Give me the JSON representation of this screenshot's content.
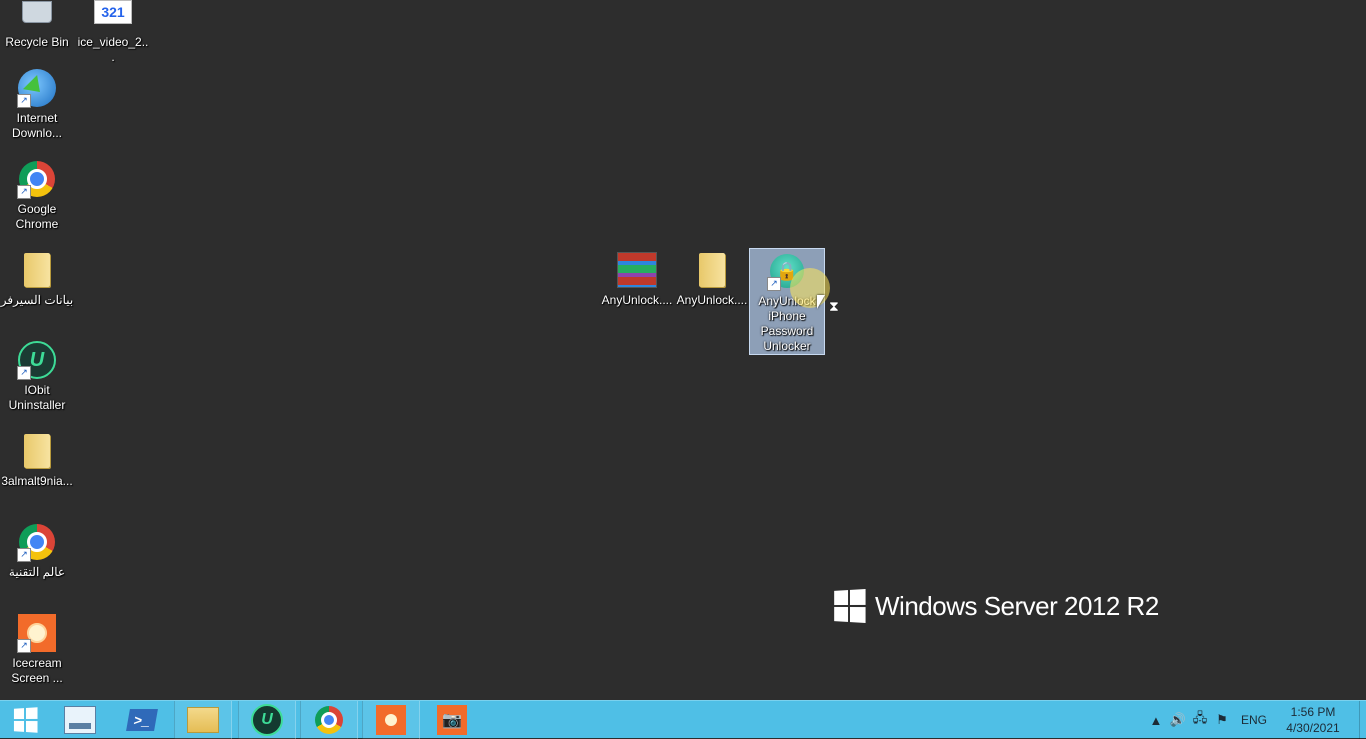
{
  "desktop": {
    "background": "#2d2d2d",
    "icons": {
      "recycle_bin": "Recycle Bin",
      "ice_video": "ice_video_2...",
      "ice_video_badge": "321",
      "internet_download": "Internet Downlo...",
      "google_chrome": "Google Chrome",
      "server_data_folder": "بيانات السيرفر",
      "iobit_uninstaller": "IObit Uninstaller",
      "folder_3almalt9nia": "3almalt9nia...",
      "chrome_tech_world": "عالم التقنية",
      "icecream_screen": "Icecream Screen ...",
      "anyunlock_archive": "AnyUnlock....",
      "anyunlock_folder": "AnyUnlock....",
      "anyunlock_shortcut": "AnyUnlock iPhone Password Unlocker"
    },
    "watermark": "Windows Server 2012 R2"
  },
  "taskbar": {
    "color": "#4fbfe6",
    "buttons": [
      "start-icon",
      "server-manager-icon",
      "powershell-icon",
      "file-explorer-icon",
      "iobit-icon",
      "chrome-icon",
      "icecream-recorder-icon",
      "icecream-screenshot-icon"
    ],
    "iobit_glyph": "U",
    "powershell_glyph": ">_",
    "tray": {
      "language": "ENG",
      "time": "1:56 PM",
      "date": "4/30/2021"
    }
  }
}
